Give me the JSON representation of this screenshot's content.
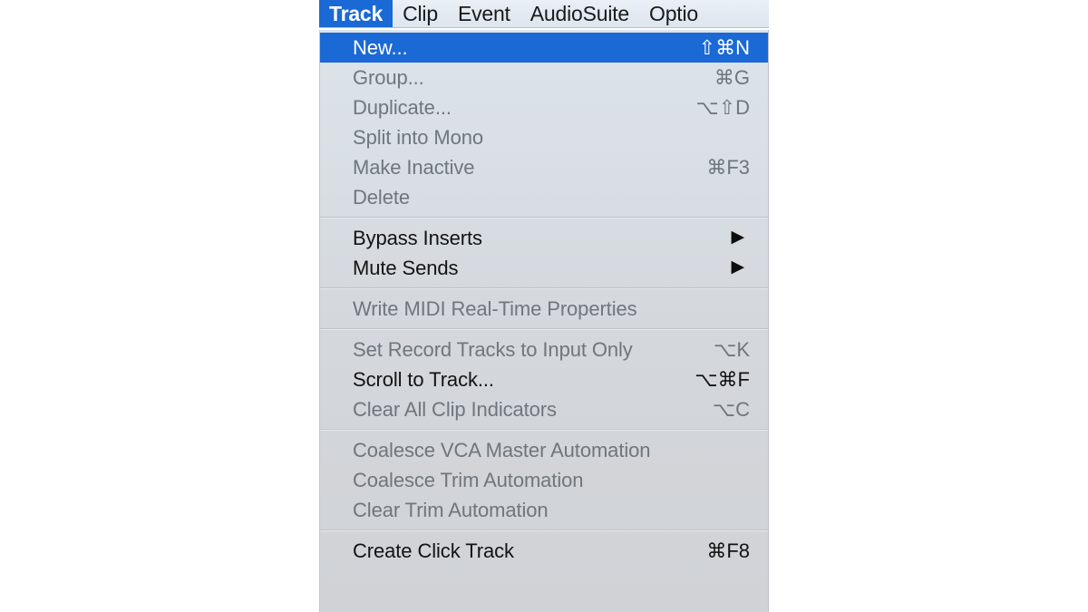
{
  "menubar": {
    "items": [
      {
        "label": "Track",
        "active": true
      },
      {
        "label": "Clip",
        "active": false
      },
      {
        "label": "Event",
        "active": false
      },
      {
        "label": "AudioSuite",
        "active": false
      },
      {
        "label": "Optio",
        "active": false
      }
    ]
  },
  "colors": {
    "highlight_blue": "#1a69d5",
    "menubar_bg": "#e3eaf1",
    "menu_bg": "#d6dae0",
    "disabled_text": "#6f767d",
    "enabled_text": "#131313",
    "separator": "#bfc3c7"
  },
  "menu": {
    "title": "Track",
    "groups": [
      {
        "items": [
          {
            "label": "New...",
            "shortcut": "⇧⌘N",
            "enabled": true,
            "selected": true,
            "submenu": false
          },
          {
            "label": "Group...",
            "shortcut": "⌘G",
            "enabled": false,
            "selected": false,
            "submenu": false
          },
          {
            "label": "Duplicate...",
            "shortcut": "⌥⇧D",
            "enabled": false,
            "selected": false,
            "submenu": false
          },
          {
            "label": "Split into Mono",
            "shortcut": "",
            "enabled": false,
            "selected": false,
            "submenu": false
          },
          {
            "label": "Make Inactive",
            "shortcut": "⌘F3",
            "enabled": false,
            "selected": false,
            "submenu": false
          },
          {
            "label": "Delete",
            "shortcut": "",
            "enabled": false,
            "selected": false,
            "submenu": false
          }
        ]
      },
      {
        "items": [
          {
            "label": "Bypass Inserts",
            "shortcut": "",
            "enabled": true,
            "selected": false,
            "submenu": true
          },
          {
            "label": "Mute Sends",
            "shortcut": "",
            "enabled": true,
            "selected": false,
            "submenu": true
          }
        ]
      },
      {
        "items": [
          {
            "label": "Write MIDI Real-Time Properties",
            "shortcut": "",
            "enabled": false,
            "selected": false,
            "submenu": false
          }
        ]
      },
      {
        "items": [
          {
            "label": "Set Record Tracks to Input Only",
            "shortcut": "⌥K",
            "enabled": false,
            "selected": false,
            "submenu": false
          },
          {
            "label": "Scroll to Track...",
            "shortcut": "⌥⌘F",
            "enabled": true,
            "selected": false,
            "submenu": false
          },
          {
            "label": "Clear All Clip Indicators",
            "shortcut": "⌥C",
            "enabled": false,
            "selected": false,
            "submenu": false
          }
        ]
      },
      {
        "items": [
          {
            "label": "Coalesce VCA Master Automation",
            "shortcut": "",
            "enabled": false,
            "selected": false,
            "submenu": false
          },
          {
            "label": "Coalesce Trim Automation",
            "shortcut": "",
            "enabled": false,
            "selected": false,
            "submenu": false
          },
          {
            "label": "Clear Trim Automation",
            "shortcut": "",
            "enabled": false,
            "selected": false,
            "submenu": false
          }
        ]
      },
      {
        "items": [
          {
            "label": "Create Click Track",
            "shortcut": "⌘F8",
            "enabled": true,
            "selected": false,
            "submenu": false
          }
        ]
      }
    ],
    "submenu_arrow_glyph": "▶"
  }
}
